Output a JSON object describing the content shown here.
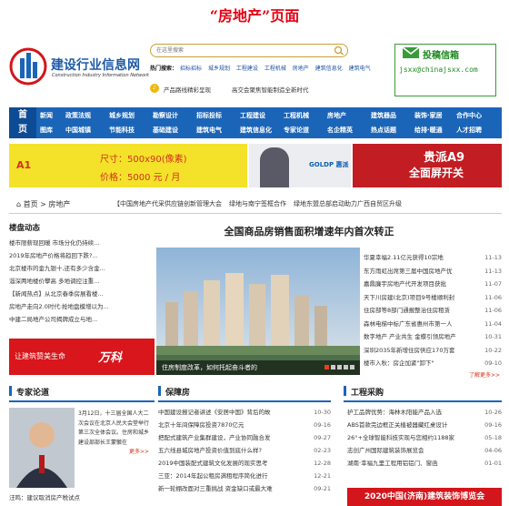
{
  "page_heading": "“房地产”页面",
  "header": {
    "logo_title": "建设行业信息网",
    "logo_subtitle": "Construction Industry Information Network",
    "search_placeholder": "在这里搜索",
    "hot_label": "热门搜索：",
    "hot_links": [
      "招标招标",
      "城乡规划",
      "工程建设",
      "工程机械",
      "房地产",
      "建筑信息化",
      "建筑电气"
    ],
    "notice_1": "产品路线精彩呈现",
    "notice_2": "高交会聚焦智能制造全新时代",
    "contrib_title": "投稿信箱",
    "contrib_email": "jsxx@chinajsxx.com"
  },
  "nav": {
    "home_1": "首",
    "home_2": "页",
    "row1": [
      "新闻",
      "政策法规",
      "城乡规划",
      "勘察设计",
      "招标投标",
      "工程建设",
      "工程机械",
      "房地产",
      "建筑器品",
      "装饰·家居",
      "合作中心"
    ],
    "row2": [
      "图库",
      "中国城镇",
      "节能科技",
      "基础建设",
      "建筑电气",
      "建筑信息化",
      "专家论道",
      "名企精英",
      "热点话题",
      "给排·暖通",
      "人才招聘"
    ]
  },
  "banner": {
    "a1": "A1",
    "size": "尺寸：500x90(像素)",
    "price": "价格：5000 元 / 月",
    "brand": "GOLDP 惠派",
    "right_1": "贵派A9",
    "right_2": "全面屏开关"
  },
  "breadcrumb": {
    "text": "⌂ 首页 > 房地产",
    "notices": [
      "【中国房地产代采供应链创新管理大会",
      "绿地与南宁签框合作",
      "绿地东盟总部启动助力广西自贸区升级"
    ]
  },
  "left": {
    "title": "楼盘动态",
    "items": [
      "楼市限薪现回暖 市场分化仍持续...",
      "2019年房地产价格将趋回下跌?...",
      "北京楼市的金九银十,还有多少含金...",
      "淄深两地楼价攀高 多地调控注重...",
      "【新闻热点】从北京春季房展看楼...",
      "房地产走向2.0时代:抢地盘模增以为...",
      "中建二局地产公司揭牌成立与地..."
    ],
    "ad_text": "让建筑赞美生命",
    "ad_brand": "万科"
  },
  "feature": {
    "headline": "全国商品房销售面积增速年内首次转正",
    "caption": "住房制度改革，如何托起奋斗者的"
  },
  "right_list": [
    {
      "t": "华夏幸福2.11亿元获得10宗地",
      "d": "11-13"
    },
    {
      "t": "东方雨虹出席第三届中国房地产优",
      "d": "11-13"
    },
    {
      "t": "嘉鼎廉宇房地产代开发项目获批",
      "d": "11-07"
    },
    {
      "t": "天下川房建(北京)项目9号楼顺利封",
      "d": "11-06"
    },
    {
      "t": "住房部等8部门通报整治住房租赁",
      "d": "11-06"
    },
    {
      "t": "森林电梯中标广东省惠州市第一人",
      "d": "11-04"
    },
    {
      "t": "数字地产 产业共生 金蝶引领房地产",
      "d": "10-31"
    },
    {
      "t": "深圳2035年新增住房供应170万套",
      "d": "10-22"
    },
    {
      "t": "楼市入秋：房企加紧\"卸下\"",
      "d": "09-10"
    }
  ],
  "right_more": "了解更多>>",
  "expert": {
    "title": "专家论道",
    "text": "3月12日，十三届全国人大二次会议在北京人民大会堂举行第三次全体会议。住房和城乡建设部部长王蒙徽在",
    "more": "更多>>",
    "caption": "汪鸣：建议取消房产税试点"
  },
  "housing": {
    "title": "保障房",
    "items": [
      {
        "t": "中国建设报记者讲述《安居中国》背后的故",
        "d": "10-30"
      },
      {
        "t": "北京十年间保障房投资7870亿元",
        "d": "09-16"
      },
      {
        "t": "把配式建筑产业集群建设，产业协同融合发",
        "d": "09-27"
      },
      {
        "t": "五六线县城房地产投资价值到底什么样?",
        "d": "02-23"
      },
      {
        "t": "2019中国装配式建筑文化发展的现实思考",
        "d": "12-28"
      },
      {
        "t": "三亚：2014年起公租房满租程序简化进行",
        "d": "12-21"
      },
      {
        "t": "新一轮棚改面对三重挑战 资金缺口或最大难",
        "d": "09-21"
      }
    ]
  },
  "procurement": {
    "title": "工程采购",
    "items": [
      {
        "t": "护工品牌优势：海林木阳能产品入选",
        "d": "10-26"
      },
      {
        "t": "ABS首款完边框正关植被器藏红桌设计",
        "d": "09-16"
      },
      {
        "t": "26°+全球智能科技实现与您相约1188家",
        "d": "05-18"
      },
      {
        "t": "志创广州国际建筑装饰展览会",
        "d": "04-06"
      },
      {
        "t": "湖南·幸福九里工程用铝铝门、窗函",
        "d": "01-01"
      }
    ],
    "ad": "2020中国(济南)建筑装饰博览会"
  },
  "colors": {
    "brand_blue": "#1b65b8",
    "accent_red": "#e60012",
    "ad_yellow": "#f4e22a",
    "contrib_green": "#1e8b1e"
  }
}
